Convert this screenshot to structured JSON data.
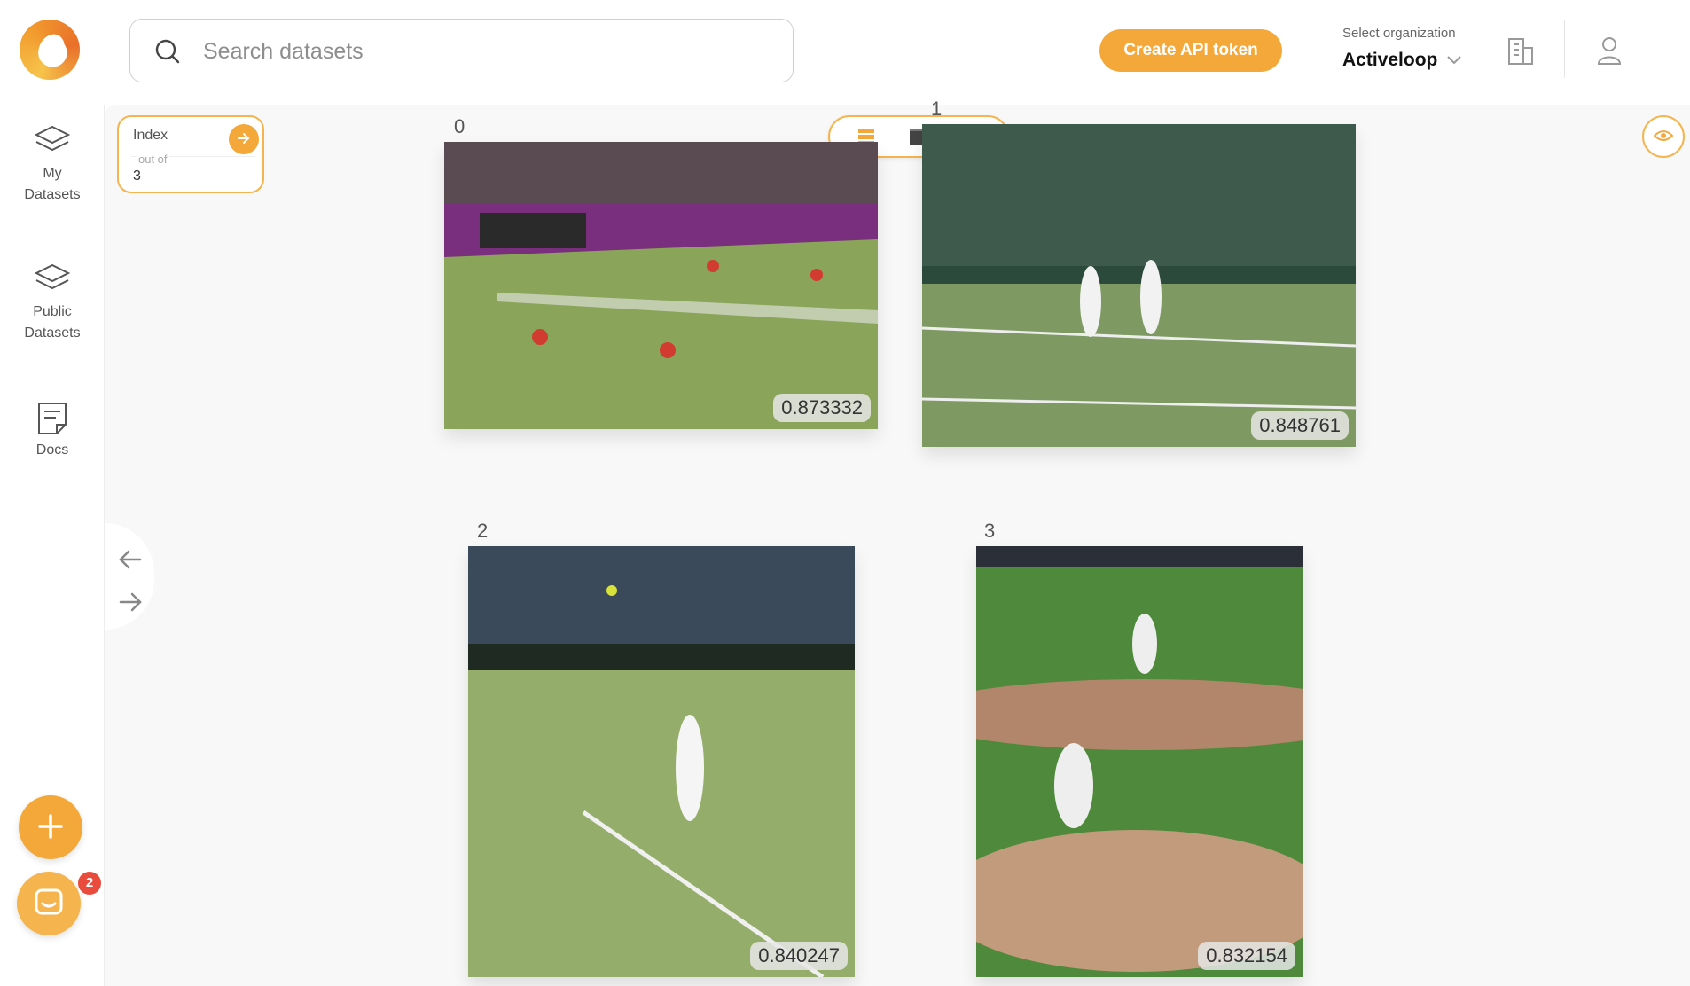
{
  "header": {
    "search_placeholder": "Search datasets",
    "api_button_label": "Create API token",
    "org_label": "Select organization",
    "org_name": "Activeloop",
    "accent_color": "#f5a83a"
  },
  "sidebar": {
    "items": [
      {
        "label_line1": "My",
        "label_line2": "Datasets",
        "icon": "layers-icon"
      },
      {
        "label_line1": "Public",
        "label_line2": "Datasets",
        "icon": "layers-icon"
      },
      {
        "label_line1": "Docs",
        "label_line2": "",
        "icon": "document-icon"
      }
    ],
    "add_button_icon": "plus-icon",
    "chat_icon": "chat-icon",
    "chat_badge_count": "2"
  },
  "viewer": {
    "index_label": "Index",
    "out_of_label": "out of",
    "total": "3",
    "view_modes": [
      "list-view-icon",
      "single-view-icon",
      "embedding-view-icon"
    ],
    "samples": [
      {
        "index": "0",
        "score": "0.873332",
        "scene": "tennis doubles on grass court"
      },
      {
        "index": "1",
        "score": "0.848761",
        "scene": "two tennis players shaking hands"
      },
      {
        "index": "2",
        "score": "0.840247",
        "scene": "tennis player serving"
      },
      {
        "index": "3",
        "score": "0.832154",
        "scene": "baseball pitcher and infielder"
      }
    ]
  }
}
